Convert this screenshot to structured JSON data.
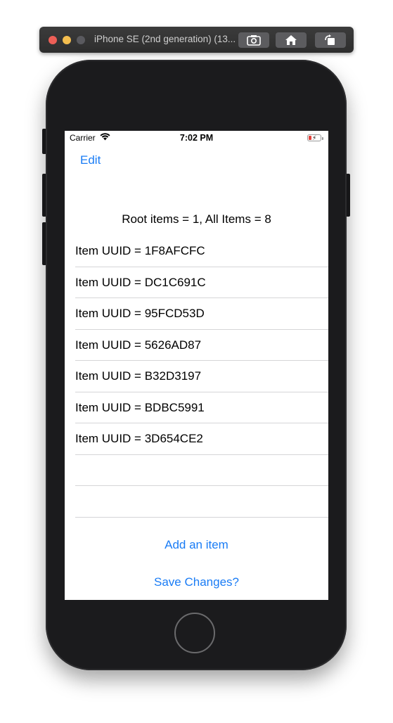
{
  "simulator": {
    "title": "iPhone SE (2nd generation) (13..."
  },
  "status_bar": {
    "carrier": "Carrier",
    "time": "7:02 PM"
  },
  "nav": {
    "edit_label": "Edit"
  },
  "summary": "Root items = 1, All Items = 8",
  "items": [
    {
      "label": "Item UUID = 1F8AFCFC"
    },
    {
      "label": "Item UUID = DC1C691C"
    },
    {
      "label": "Item UUID = 95FCD53D"
    },
    {
      "label": "Item UUID = 5626AD87"
    },
    {
      "label": "Item UUID = B32D3197"
    },
    {
      "label": "Item UUID = BDBC5991"
    },
    {
      "label": "Item UUID = 3D654CE2"
    },
    {
      "label": ""
    },
    {
      "label": ""
    }
  ],
  "actions": {
    "add_label": "Add an item",
    "save_label": "Save Changes?"
  },
  "colors": {
    "accent": "#1a7cf5",
    "separator": "#d5d5d7",
    "phone_body": "#1b1b1d",
    "battery_low": "#e2413b"
  }
}
